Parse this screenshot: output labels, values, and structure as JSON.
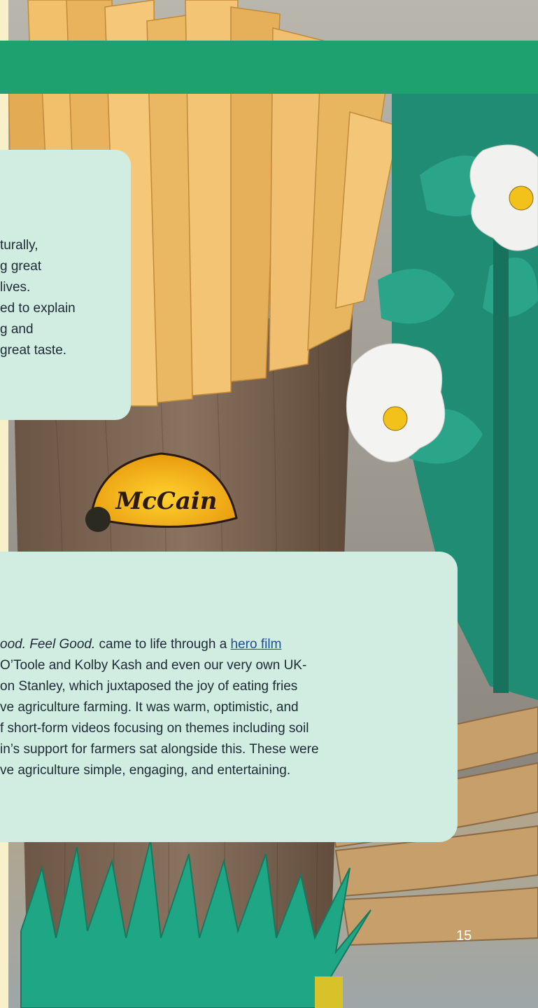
{
  "card_top": {
    "lines": [
      "turally,",
      "g great",
      "lives.",
      "ed to explain",
      "g and",
      "great taste."
    ]
  },
  "card_bottom": {
    "line1_prefix": "ood. Feel Good.",
    "line1_mid": " came to life through a ",
    "line1_link": "hero film",
    "lines": [
      "O’Toole and Kolby Kash and even our very own UK-",
      "on Stanley, which juxtaposed the joy of eating fries",
      "ve agriculture farming. It was warm, optimistic, and",
      "f short-form videos focusing on themes including soil",
      "in’s support for farmers sat alongside this. These were",
      "ve agriculture simple, engaging, and entertaining."
    ]
  },
  "logo": {
    "text": "McCain"
  },
  "page": {
    "number": "15"
  },
  "colors": {
    "banner": "#1fa06f",
    "card": "#d1ece1",
    "text": "#1c2b33",
    "link": "#1d4f8f"
  }
}
